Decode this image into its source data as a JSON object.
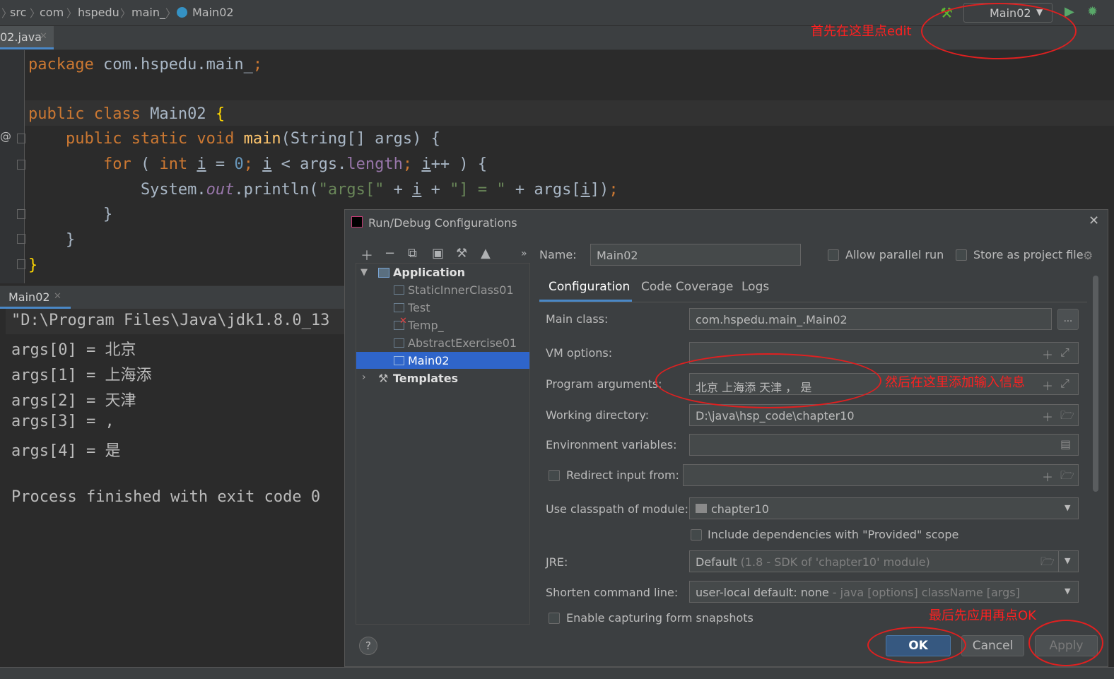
{
  "breadcrumb": [
    "src",
    "com",
    "hspedu",
    "main_",
    "Main02"
  ],
  "run_config": "Main02",
  "file_tab": "02.java",
  "code_lines": [
    {
      "parts": [
        [
          "kw",
          "package "
        ],
        [
          "",
          "com.hspedu.main_"
        ],
        [
          "kw",
          ";"
        ]
      ]
    },
    {
      "parts": [
        [
          "kw",
          "public class "
        ],
        [
          "",
          "Main02 "
        ],
        [
          "brk",
          "{"
        ]
      ]
    },
    {
      "parts": [
        [
          "",
          "    "
        ],
        [
          "kw",
          "public static void "
        ],
        [
          "fn",
          "main"
        ],
        [
          "",
          "(String[] args) {"
        ]
      ]
    },
    {
      "parts": [
        [
          "",
          "        "
        ],
        [
          "kw",
          "for "
        ],
        [
          "",
          "( "
        ],
        [
          "kw",
          "int "
        ],
        [
          "und",
          "i"
        ],
        [
          "",
          " = "
        ],
        [
          "num",
          "0"
        ],
        [
          "kw",
          "; "
        ],
        [
          "und",
          "i"
        ],
        [
          "",
          " < args."
        ],
        [
          "prop",
          "length"
        ],
        [
          "kw",
          "; "
        ],
        [
          "und",
          "i"
        ],
        [
          "",
          "++ ) {"
        ]
      ]
    },
    {
      "parts": [
        [
          "",
          "            System."
        ],
        [
          "fld",
          "out"
        ],
        [
          "",
          ".println("
        ],
        [
          "str",
          "\"args[\""
        ],
        [
          "",
          " + "
        ],
        [
          "und",
          "i"
        ],
        [
          "",
          " + "
        ],
        [
          "str",
          "\"] = \""
        ],
        [
          "",
          " + args["
        ],
        [
          "und",
          "i"
        ],
        [
          "",
          "])"
        ],
        [
          "kw",
          ";"
        ]
      ]
    },
    {
      "parts": [
        [
          "",
          "        }"
        ]
      ]
    },
    {
      "parts": [
        [
          "",
          "    }"
        ]
      ]
    },
    {
      "parts": [
        [
          "brk",
          "}"
        ]
      ]
    }
  ],
  "console_tab": "Main02",
  "console_lines": [
    "\"D:\\Program Files\\Java\\jdk1.8.0_13",
    "args[0] = 北京",
    "args[1] = 上海添",
    "args[2] = 天津",
    "args[3] = ,",
    "args[4] = 是",
    "",
    "Process finished with exit code 0"
  ],
  "dialog": {
    "title": "Run/Debug Configurations",
    "name_label": "Name:",
    "name_value": "Main02",
    "allow_parallel": "Allow parallel run",
    "store_project": "Store as project file",
    "tree": {
      "application": "Application",
      "children": [
        "StaticInnerClass01",
        "Test",
        "Temp_",
        "AbstractExercise01",
        "Main02"
      ],
      "templates": "Templates"
    },
    "tabs": [
      "Configuration",
      "Code Coverage",
      "Logs"
    ],
    "main_class_label": "Main class:",
    "main_class_value": "com.hspedu.main_.Main02",
    "vm_options_label": "VM options:",
    "program_args_label": "Program arguments:",
    "program_args_value": "北京  上海添  天津 ，  是",
    "working_dir_label": "Working directory:",
    "working_dir_value": "D:\\java\\hsp_code\\chapter10",
    "env_vars_label": "Environment variables:",
    "redirect_label": "Redirect input from:",
    "classpath_label": "Use classpath of module:",
    "classpath_value": "chapter10",
    "include_deps": "Include dependencies with \"Provided\" scope",
    "jre_label": "JRE:",
    "jre_value": "Default",
    "jre_hint": "(1.8 - SDK of 'chapter10' module)",
    "shorten_label": "Shorten command line:",
    "shorten_value": "user-local default: none",
    "shorten_hint": "- java [options] className [args]",
    "capture_label": "Enable capturing form snapshots",
    "ok": "OK",
    "cancel": "Cancel",
    "apply": "Apply",
    "help": "?"
  },
  "annotations": {
    "edit": "首先在这里点edit",
    "args": "然后在这里添加输入信息",
    "ok": "最后先应用再点OK"
  },
  "colors": {
    "accent": "#4a88c7",
    "annotation": "#ff2020",
    "selection": "#2f65ca",
    "ok_button": "#365880"
  }
}
